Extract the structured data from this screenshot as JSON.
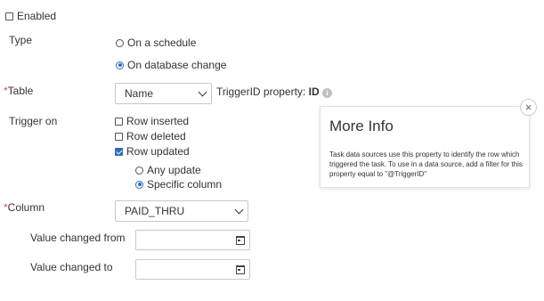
{
  "enabled": {
    "label": "Enabled",
    "checked": false
  },
  "type": {
    "label": "Type",
    "options": [
      {
        "label": "On a schedule",
        "selected": false
      },
      {
        "label": "On database change",
        "selected": true
      }
    ]
  },
  "table": {
    "required_mark": "*",
    "label": "Table",
    "value": "Name",
    "trigger_id_prefix": "TriggerID property:",
    "trigger_id_value": "ID",
    "info_icon": "i"
  },
  "trigger_on": {
    "label": "Trigger on",
    "checks": [
      {
        "label": "Row inserted",
        "checked": false
      },
      {
        "label": "Row deleted",
        "checked": false
      },
      {
        "label": "Row updated",
        "checked": true
      }
    ],
    "update_modes": [
      {
        "label": "Any update",
        "selected": false
      },
      {
        "label": "Specific column",
        "selected": true
      }
    ]
  },
  "column": {
    "required_mark": "*",
    "label": "Column",
    "value": "PAID_THRU"
  },
  "value_changed_from": {
    "label": "Value changed from",
    "value": ""
  },
  "value_changed_to": {
    "label": "Value changed to",
    "value": ""
  },
  "popup": {
    "title": "More Info",
    "close_glyph": "×",
    "body": "Task data sources use this property to identify the row which triggered the task. To use in a data source, add a filter for this property equal to \"@TriggerID\""
  },
  "colors": {
    "accent": "#2a6ebb",
    "required": "#d9534f",
    "text": "#333333"
  }
}
